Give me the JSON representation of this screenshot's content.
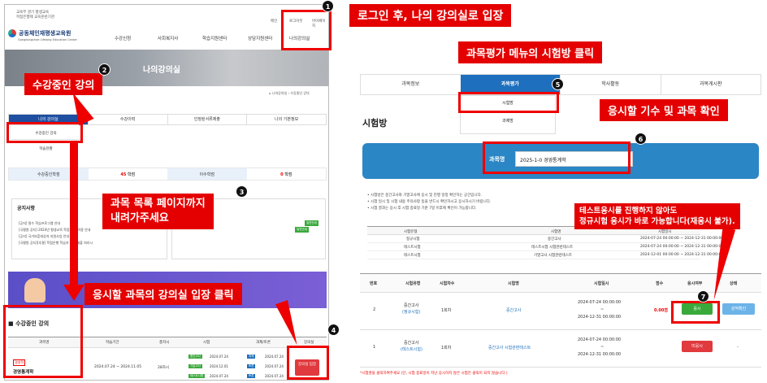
{
  "left": {
    "logo_small_lines": [
      "교육부 경기 평생교육",
      "학점은행제 교육훈련기관"
    ],
    "logo_name": "공동체인재평생교육원",
    "logo_sub": "Gongdongchae Lifelong Education Center",
    "top_links": [
      "메인",
      "로그아웃",
      "마이페이지"
    ],
    "nav": [
      "수강신청",
      "사회복지사",
      "학습지원센터",
      "상담지원센터",
      "나의강의실"
    ],
    "hero_title": "나의강의실",
    "breadcrumb": "⌂  나의강의실  ›  수강중인 강의",
    "tabs": [
      "나의 강의실",
      "수강이력",
      "인정된서류제출",
      "나의 기본정보"
    ],
    "subtab1": "수강중인 강의",
    "subtab2": "학습현황",
    "stats": {
      "label1": "수강중인학점",
      "value1": "45",
      "unit1": "학점",
      "label2": "이수학점",
      "value2": "0",
      "unit2": "학점"
    },
    "notice_title": "공지사항",
    "notices": [
      "[공지] 필수 학습프로그램 안내",
      "[국평원 공지] 2024년 평생교육 학점 인정 이용 안내",
      "[공지] 국가보훈대상자 지원사업 안내",
      "[국평원 공지][추결] 학점은행 학습자 포털 제출 처리시"
    ],
    "badge1": "일반안내",
    "badge2": "일반안내",
    "course_section_title": "수강중인 강의",
    "course_headers": [
      "과목명",
      "학습기간",
      "총차시",
      "시험",
      "과제/토론",
      "강의실"
    ],
    "course": {
      "tag": "경영학",
      "name": "경영통계학",
      "period": "2024.07.24 ~ 2024.11.05",
      "sessions": "28차시",
      "exams": [
        {
          "label": "중간고사",
          "date": "2024.07.24"
        },
        {
          "label": "기말고사",
          "date": "2024.12.01"
        },
        {
          "label": "테스트시험",
          "date": "2024.07.24"
        }
      ],
      "tasks": [
        {
          "label": "과제",
          "date": "2024.07.24"
        },
        {
          "label": "토론",
          "date": "2024.07.24"
        },
        {
          "label": "토론",
          "date": "2024.07.24"
        }
      ],
      "enter": "강의실 입장"
    }
  },
  "right": {
    "tabs": [
      "과목정보",
      "과목평가",
      "학사활동",
      "과목게시판"
    ],
    "dropdown": [
      "시험방",
      "과제방"
    ],
    "page_title": "시험방",
    "subject_label": "과목명",
    "subject_value": "2025-1-0  경영통계학",
    "info_lines": [
      "• 시험방은 중간고사와 기말고사에 응시 및 진행 일정 확인하는 공간입니다.",
      "• 시험 일시 및 시험 내용 주의사항 등을 반드시 확인하시고 응시하시기 바랍니다.",
      "• 시험 결과는 응시 후 시험 종료일 기준 7일 이후에 확인이 가능합니다."
    ],
    "sched_headers": [
      "시험유형",
      "시험명",
      "시험일시"
    ],
    "sched_rows": [
      [
        "정규시험",
        "중간고사",
        "2024-07-24 00:00:00 ~ 2024-12-31 00:00:00"
      ],
      [
        "테스트시험",
        "테스트시험 시험관련테스트",
        "2024-07-24 00:00:00 ~ 2024-12-31 00:00:00"
      ],
      [
        "테스트시험",
        "기말고사 시험관련테스트",
        "2024-12-01 00:00:00 ~ 2024-12-31 00:00:00"
      ]
    ],
    "exam_headers": [
      "번호",
      "시험유형",
      "시험차수",
      "시험명",
      "시험일시",
      "점수",
      "응시여부",
      "상태"
    ],
    "exam_rows": [
      {
        "no": "2",
        "type": "중간고사",
        "type_sub": "(정규시험)",
        "round": "1회차",
        "name": "중간고사",
        "start": "2024-07-24 00:00:00",
        "tilde": "~",
        "end": "2024-12-31 00:00:00",
        "score": "0.00점",
        "action": "응시",
        "status": "성적확인"
      },
      {
        "no": "1",
        "type": "중간고사",
        "type_sub": "(테스트시험)",
        "round": "1회차",
        "name": "중간고사 시험관련테스트",
        "start": "2024-07-24 00:00:00",
        "tilde": "~",
        "end": "2024-12-31 00:00:00",
        "score": "",
        "action": "미응시",
        "status": "-"
      }
    ],
    "footnote": "*시험명을 클릭하여주세요 (단, 시험 종료일이 지난 응시하지 않은 시험은 클릭이 되지 않습니다.)"
  },
  "callouts": {
    "c1": "로그인 후, 나의 강의실로 입장",
    "c2": "수강중인 강의",
    "c3_line1": "과목 목록 페이지까지",
    "c3_line2": "내려가주세요",
    "c4": "응시할 과목의 강의실 입장 클릭",
    "c5": "과목평가 메뉴의 시험방 클릭",
    "c6": "응시할 기수 및 과목 확인",
    "c7_line1": "테스트응시를 진행하지 않아도",
    "c7_line2": "정규시험 응시가 바로 가능합니다(재응시 불가)."
  },
  "numbers": [
    "1",
    "2",
    "3",
    "4",
    "5",
    "6",
    "7"
  ],
  "colors": {
    "callout_red": "#e40000",
    "tab_blue": "#1e6fbd",
    "banner_blue": "#2b86c5",
    "btn_green": "#3aa93c",
    "btn_red": "#e0393e",
    "btn_lightblue": "#6cb3e8"
  }
}
